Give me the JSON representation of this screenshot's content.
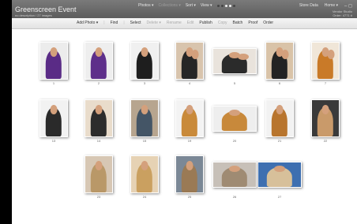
{
  "window": {
    "title": "Greenscreen Event",
    "subtitle": "no description / 27 images",
    "brand_line1": "Vendor Studio",
    "brand_line2": "Order: 4771 #"
  },
  "top_menu": {
    "photos": "Photos ▾",
    "collections": "Collections ▾",
    "sort": "Sort ▾",
    "view": "View ▾",
    "store": "Store Data",
    "home": "Home ▾"
  },
  "toolbar": {
    "add_photo": "Add Photo ▾",
    "find": "Find",
    "select": "Select",
    "delete": "Delete ▾",
    "rename": "Rename",
    "edit": "Edit",
    "publish": "Publish",
    "copy": "Copy",
    "batch": "Batch",
    "proof": "Proof",
    "order": "Order"
  },
  "photos": [
    {
      "label": "1",
      "kind": "gown",
      "bg": "#ececec",
      "fig": "#5a2b86",
      "orient": "portrait"
    },
    {
      "label": "2",
      "kind": "gown",
      "bg": "#eeeeee",
      "fig": "#5e2f8a",
      "orient": "portrait"
    },
    {
      "label": "3",
      "kind": "suit",
      "bg": "#f0f0f0",
      "fig": "#1e1e1e",
      "orient": "portrait"
    },
    {
      "label": "4",
      "kind": "couple",
      "bg": "#d8c4ad",
      "fig": "#262626",
      "orient": "portrait"
    },
    {
      "label": "5",
      "kind": "couple",
      "bg": "#e9e3dc",
      "fig": "#2b2b2b",
      "orient": "landscape"
    },
    {
      "label": "6",
      "kind": "couple",
      "bg": "#d9c3a8",
      "fig": "#232323",
      "orient": "portrait"
    },
    {
      "label": "7",
      "kind": "couple",
      "bg": "#f0e6d8",
      "fig": "#c97a28",
      "orient": "portrait"
    },
    {
      "label": "13",
      "kind": "scarf",
      "bg": "#f2f2f2",
      "fig": "#2a2a2a",
      "orient": "portrait"
    },
    {
      "label": "14",
      "kind": "scarf",
      "bg": "#e9dccb",
      "fig": "#2c2c2c",
      "orient": "portrait"
    },
    {
      "label": "15",
      "kind": "casual",
      "bg": "#b7a58f",
      "fig": "#445566",
      "orient": "portrait"
    },
    {
      "label": "19",
      "kind": "blonde",
      "bg": "#f3f3f3",
      "fig": "#c98a3a",
      "orient": "portrait"
    },
    {
      "label": "20",
      "kind": "blonde",
      "bg": "#eeeeee",
      "fig": "#c8893b",
      "orient": "landscape"
    },
    {
      "label": "21",
      "kind": "blonde",
      "bg": "#f2f2f2",
      "fig": "#b8752e",
      "orient": "portrait"
    },
    {
      "label": "22",
      "kind": "blonde",
      "bg": "#3a3a3a",
      "fig": "#c99a6a",
      "orient": "portrait"
    },
    {
      "label": "23",
      "kind": "blonde",
      "bg": "#d7c7b4",
      "fig": "#b99868",
      "orient": "portrait"
    },
    {
      "label": "24",
      "kind": "blonde",
      "bg": "#e6d2b4",
      "fig": "#caa060",
      "orient": "portrait"
    },
    {
      "label": "25",
      "kind": "blonde",
      "bg": "#7b8896",
      "fig": "#9a7a55",
      "orient": "portrait"
    },
    {
      "label": "26",
      "kind": "blonde",
      "bg": "#c7c0b8",
      "fig": "#9f8b73",
      "orient": "landscape"
    },
    {
      "label": "27",
      "kind": "blonde",
      "bg": "#3e6fb0",
      "fig": "#d7c09a",
      "orient": "landscape"
    }
  ]
}
